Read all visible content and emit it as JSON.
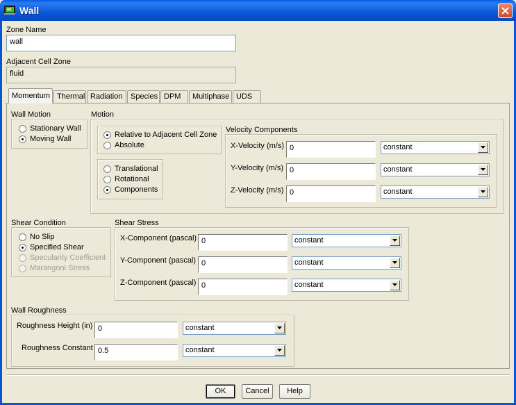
{
  "window": {
    "title": "Wall"
  },
  "zone_name": {
    "label": "Zone Name",
    "value": "wall"
  },
  "adjacent_cell_zone": {
    "label": "Adjacent Cell Zone",
    "value": "fluid"
  },
  "tabs": [
    "Momentum",
    "Thermal",
    "Radiation",
    "Species",
    "DPM",
    "Multiphase",
    "UDS"
  ],
  "active_tab": "Momentum",
  "wall_motion": {
    "label": "Wall Motion",
    "options": [
      "Stationary Wall",
      "Moving Wall"
    ],
    "selected": "Moving Wall"
  },
  "motion": {
    "label": "Motion",
    "relative_options": [
      "Relative to Adjacent Cell Zone",
      "Absolute"
    ],
    "relative_selected": "Relative to Adjacent Cell Zone",
    "type_options": [
      "Translational",
      "Rotational",
      "Components"
    ],
    "type_selected": "Components"
  },
  "velocity_components": {
    "label": "Velocity Components",
    "rows": [
      {
        "label": "X-Velocity (m/s)",
        "value": "0",
        "profile": "constant"
      },
      {
        "label": "Y-Velocity (m/s)",
        "value": "0",
        "profile": "constant"
      },
      {
        "label": "Z-Velocity (m/s)",
        "value": "0",
        "profile": "constant"
      }
    ]
  },
  "shear_condition": {
    "label": "Shear Condition",
    "options": [
      "No Slip",
      "Specified Shear",
      "Specularity Coefficient",
      "Marangoni Stress"
    ],
    "selected": "Specified Shear",
    "disabled": [
      "Specularity Coefficient",
      "Marangoni Stress"
    ]
  },
  "shear_stress": {
    "label": "Shear Stress",
    "rows": [
      {
        "label": "X-Component (pascal)",
        "value": "0",
        "profile": "constant"
      },
      {
        "label": "Y-Component (pascal)",
        "value": "0",
        "profile": "constant"
      },
      {
        "label": "Z-Component (pascal)",
        "value": "0",
        "profile": "constant"
      }
    ]
  },
  "wall_roughness": {
    "label": "Wall Roughness",
    "rows": [
      {
        "label": "Roughness Height (in)",
        "value": "0",
        "profile": "constant"
      },
      {
        "label": "Roughness Constant",
        "value": "0.5",
        "profile": "constant"
      }
    ]
  },
  "buttons": {
    "ok": "OK",
    "cancel": "Cancel",
    "help": "Help"
  },
  "colors": {
    "title_bar": "#0a58d8",
    "dialog_bg": "#ece9d8",
    "close_button": "#d24625"
  }
}
